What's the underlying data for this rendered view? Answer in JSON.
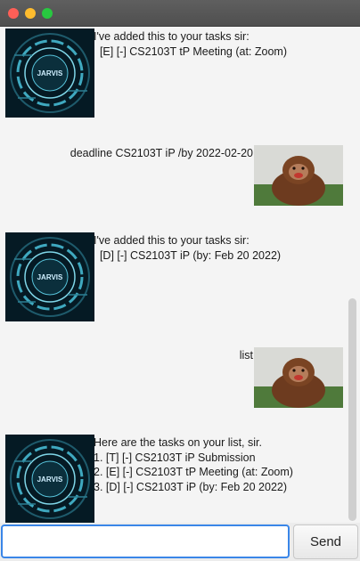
{
  "window": {
    "controls": [
      "close",
      "minimize",
      "zoom"
    ]
  },
  "messages": [
    {
      "sender": "bot",
      "text": "I've added this to your tasks sir:\n  [E] [-] CS2103T tP Meeting (at: Zoom)"
    },
    {
      "sender": "user",
      "text": "deadline CS2103T iP /by 2022-02-20"
    },
    {
      "sender": "bot",
      "text": "I've added this to your tasks sir:\n  [D] [-] CS2103T iP (by: Feb 20 2022)"
    },
    {
      "sender": "user",
      "text": "list"
    },
    {
      "sender": "bot",
      "text": "Here are the tasks on your list, sir.\n1. [T] [-] CS2103T iP Submission\n2. [E] [-] CS2103T tP Meeting (at: Zoom)\n3. [D] [-] CS2103T iP (by: Feb 20 2022)"
    }
  ],
  "avatars": {
    "bot": {
      "icon": "jarvis-avatar",
      "label": "JARVIS"
    },
    "user": {
      "icon": "orangutan-avatar"
    }
  },
  "input": {
    "value": "",
    "placeholder": ""
  },
  "send_label": "Send"
}
